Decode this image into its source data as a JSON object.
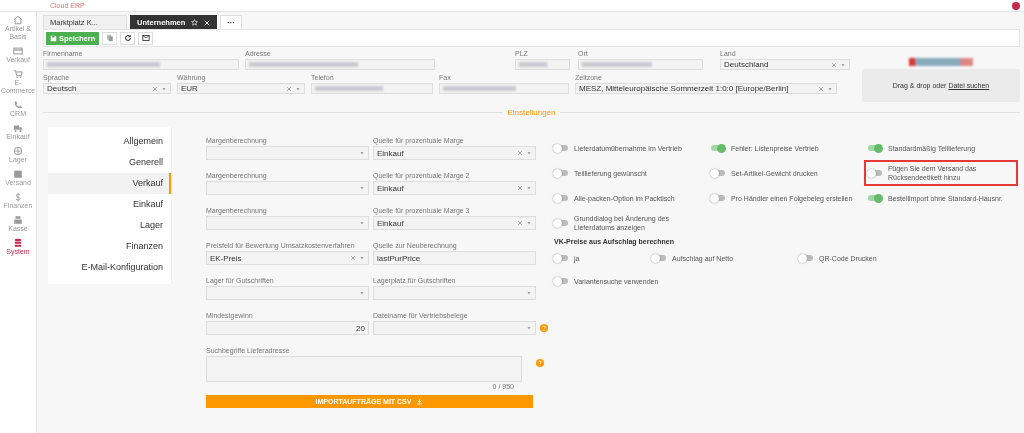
{
  "header": {
    "brand": "Cloud ERP"
  },
  "sidebar": {
    "items": [
      {
        "label": "Artikel & Basis",
        "selected": false
      },
      {
        "label": "Verkauf",
        "selected": false
      },
      {
        "label": "E-Commerce",
        "selected": false
      },
      {
        "label": "CRM",
        "selected": false
      },
      {
        "label": "Einkauf",
        "selected": false
      },
      {
        "label": "Lager",
        "selected": false
      },
      {
        "label": "Versand",
        "selected": false
      },
      {
        "label": "Finanzen",
        "selected": false
      },
      {
        "label": "Kasse",
        "selected": false
      },
      {
        "label": "System",
        "selected": true
      }
    ]
  },
  "tabs": [
    {
      "label": "Marktplatz K...",
      "selected": false
    },
    {
      "label": "Unternehmen",
      "selected": true
    },
    {
      "label": "···",
      "selected": false
    }
  ],
  "toolbar": {
    "save": "Speichern"
  },
  "company_fields": [
    [
      {
        "label": "Firmenname",
        "kind": "blurred"
      },
      {
        "label": "Adresse",
        "kind": "blurred"
      },
      {
        "label": "PLZ",
        "kind": "blurred"
      },
      {
        "label": "Ort",
        "kind": "blurred"
      },
      {
        "label": "Land",
        "kind": "select",
        "value": "Deutschland"
      }
    ],
    [
      {
        "label": "Sprache",
        "kind": "select",
        "value": "Deutsch"
      },
      {
        "label": "Währung",
        "kind": "select",
        "value": "EUR"
      },
      {
        "label": "Telefon",
        "kind": "blurred"
      },
      {
        "label": "Fax",
        "kind": "blurred"
      },
      {
        "label": "Zeitzone",
        "kind": "select",
        "value": "MESZ, Mitteleuropäische Sommerzeit 1:0:0 [Europe/Berlin]"
      }
    ]
  ],
  "upload": {
    "text": "Drag & drop oder",
    "link": "Datei suchen"
  },
  "section_title": "Einstellungen",
  "settings_nav": [
    {
      "label": "Allgemein",
      "selected": false
    },
    {
      "label": "Generell",
      "selected": false
    },
    {
      "label": "Verkauf",
      "selected": true
    },
    {
      "label": "Einkauf",
      "selected": false
    },
    {
      "label": "Lager",
      "selected": false
    },
    {
      "label": "Finanzen",
      "selected": false
    },
    {
      "label": "E-Mail-Konfiguration",
      "selected": false
    }
  ],
  "form_rows": [
    [
      {
        "label": "Margenberechnung",
        "kind": "select",
        "clearable": false,
        "help": false
      },
      {
        "label": "Quelle für prozentuale Marge",
        "kind": "select",
        "value": "Einkauf",
        "clearable": true,
        "help": false
      }
    ],
    [
      {
        "label": "Margenberechnung",
        "kind": "select",
        "clearable": false,
        "help": false
      },
      {
        "label": "Quelle für prozentuale Marge 2",
        "kind": "select",
        "value": "Einkauf",
        "clearable": true,
        "help": false
      }
    ],
    [
      {
        "label": "Margenberechnung",
        "kind": "select",
        "clearable": false,
        "help": false
      },
      {
        "label": "Quelle für prozentuale Marge 3",
        "kind": "select",
        "value": "Einkauf",
        "clearable": true,
        "help": false
      }
    ],
    [
      {
        "label": "Preisfeld für Bewertung Umsatzkostenverfahren",
        "kind": "select",
        "value": "EK-Preis",
        "clearable": true,
        "help": false
      },
      {
        "label": "Quelle zur Neuberechnung",
        "kind": "text",
        "value": "lastPurPrice",
        "help": false
      }
    ],
    [
      {
        "label": "Lager für Gutschriften",
        "kind": "select",
        "clearable": false,
        "help": false
      },
      {
        "label": "Lagerplatz für Gutschriften",
        "kind": "select",
        "clearable": false,
        "help": false
      }
    ],
    [
      {
        "label": "Mindestgewinn",
        "kind": "number",
        "value": "20",
        "help": false
      },
      {
        "label": "Dateiname für Vertriebsbelege",
        "kind": "select",
        "clearable": false,
        "help": true
      }
    ]
  ],
  "textarea": {
    "label": "Suchbegriffe Lieferadresse",
    "counter": "0 / 950",
    "help": true
  },
  "import_button": "IMPORTAUFTRÄGE MIT CSV",
  "toggles": [
    {
      "label": "Lieferdatumübernahme im Vertrieb",
      "on": false,
      "highlighted": false
    },
    {
      "label": "Fehler: Listenpreise Vertrieb",
      "on": true,
      "highlighted": false
    },
    {
      "label": "Standardmäßig Teillieferung",
      "on": true,
      "highlighted": false
    },
    {
      "label": "Teillieferung gewünscht",
      "on": false,
      "highlighted": false
    },
    {
      "label": "Set-Artikel-Gewicht drucken",
      "on": false,
      "highlighted": false
    },
    {
      "label": "Fügen Sie dem Versand das Rücksendeetikett hinzu",
      "on": false,
      "highlighted": true
    },
    {
      "label": "Alle-packen-Option im Packtisch",
      "on": false,
      "highlighted": false
    },
    {
      "label": "Pro Händler einen Folgebeleg erstellen",
      "on": false,
      "highlighted": false
    },
    {
      "label": "Bestellimport ohne Standard-Hausnr.",
      "on": true,
      "highlighted": false
    },
    {
      "label": "Grunddialog bei Änderung des Lieferdatums anzeigen",
      "on": false,
      "highlighted": false
    }
  ],
  "vk_section": {
    "title": "VK-Preise aus Aufschlag berechnen",
    "toggles": [
      {
        "label": "ja",
        "on": false
      },
      {
        "label": "Aufschlag auf Netto",
        "on": false
      },
      {
        "label": "QR-Code Drucken",
        "on": false
      }
    ]
  },
  "extra_toggles": [
    {
      "label": "Variantensuche verwenden",
      "on": false
    }
  ]
}
